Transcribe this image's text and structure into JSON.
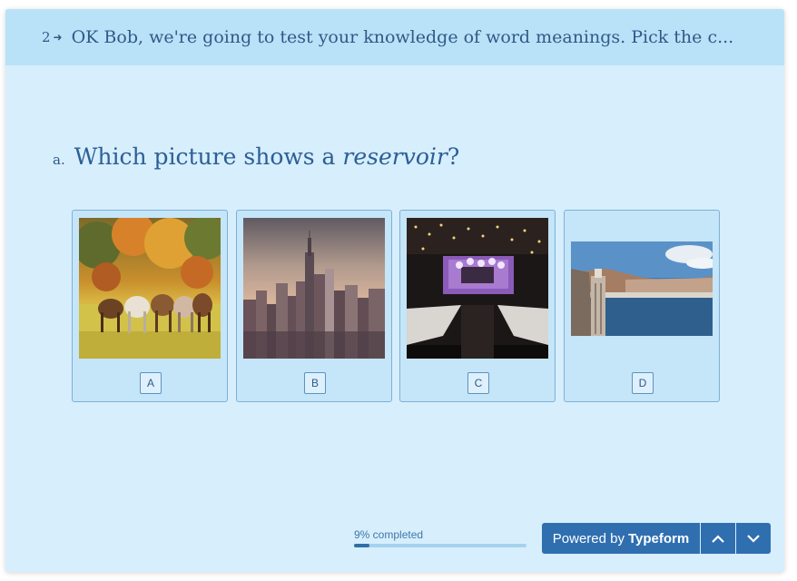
{
  "header": {
    "number": "2",
    "arrow_icon": "arrow-right-icon",
    "text": "OK Bob, we're going to test your knowledge of word meanings. Pick the c..."
  },
  "question": {
    "letter": "a.",
    "prefix": "Which picture shows a ",
    "emphasis": "reservoir",
    "suffix": "?"
  },
  "choices": [
    {
      "key": "A",
      "picture": "horses-in-meadow"
    },
    {
      "key": "B",
      "picture": "city-skyline"
    },
    {
      "key": "C",
      "picture": "restaurant-interior"
    },
    {
      "key": "D",
      "picture": "dam-reservoir"
    }
  ],
  "progress": {
    "label": "9% completed",
    "fraction": 0.09
  },
  "nav": {
    "powered_prefix": "Powered by",
    "powered_brand": "Typeform",
    "up_icon": "chevron-up-icon",
    "down_icon": "chevron-down-icon"
  },
  "colors": {
    "card_bg": "#d7eefd",
    "header_bg": "#b9e2f9",
    "accent": "#2f6fb0",
    "text": "#2f5a86"
  }
}
